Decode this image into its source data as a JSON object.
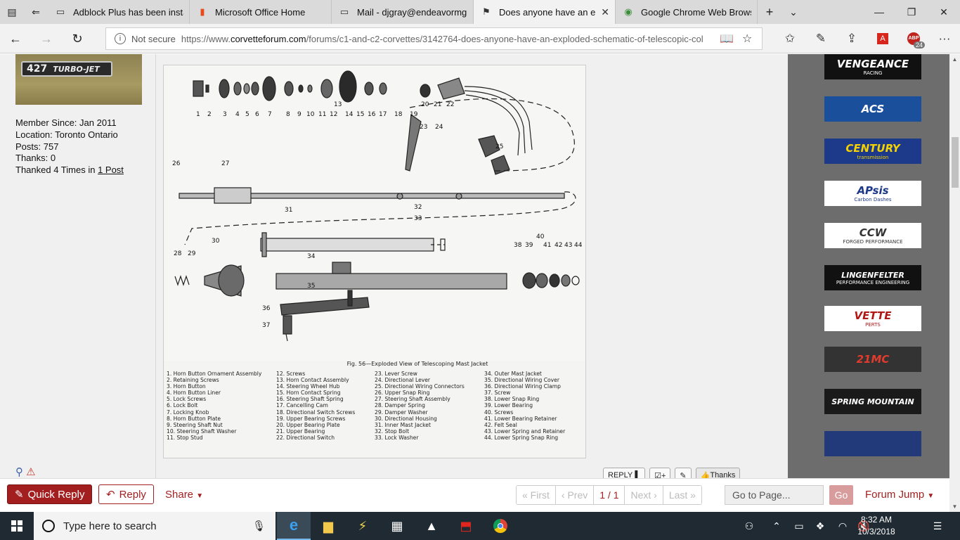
{
  "browser": {
    "tabs": [
      {
        "title": "Adblock Plus has been insta",
        "icon": "document-icon",
        "active": false
      },
      {
        "title": "Microsoft Office Home",
        "icon": "office-icon",
        "active": false
      },
      {
        "title": "Mail - djgray@endeavormg",
        "icon": "mail-icon",
        "active": false
      },
      {
        "title": "Does anyone have an e",
        "icon": "corvette-flag-icon",
        "active": true
      },
      {
        "title": "Google Chrome Web Brows",
        "icon": "chrome-icon",
        "active": false
      }
    ],
    "not_secure": "Not secure",
    "url_prefix": "https://www.",
    "url_domain": "corvetteforum.com",
    "url_path": "/forums/c1-and-c2-corvettes/3142764-does-anyone-have-an-exploded-schematic-of-telescopic-col",
    "abp_count": "24"
  },
  "member": {
    "avatar_text": "427",
    "avatar_subtext": "TURBO-JET",
    "since": "Member Since: Jan 2011",
    "location": "Location: Toronto Ontario",
    "posts": "Posts: 757",
    "thanks": "Thanks: 0",
    "thanked_prefix": "Thanked 4 Times in ",
    "thanked_link": "1 Post"
  },
  "diagram": {
    "caption": "Fig. 56—Exploded View of Telescoping Mast Jacket",
    "callouts_top": [
      "1",
      "2",
      "3",
      "4",
      "5",
      "6",
      "7",
      "8",
      "9",
      "10",
      "11",
      "12",
      "13",
      "14",
      "15",
      "16",
      "17",
      "18",
      "19",
      "20",
      "21",
      "22"
    ],
    "callouts_other": [
      "23",
      "24",
      "25",
      "26",
      "27",
      "31",
      "32",
      "33",
      "28",
      "29",
      "30",
      "34",
      "35",
      "36",
      "37",
      "38",
      "39",
      "40",
      "41",
      "42",
      "43",
      "44"
    ],
    "legend": [
      [
        "1. Horn Button Ornament Assembly",
        "2. Retaining Screws",
        "3. Horn Button",
        "4. Horn Button Liner",
        "5. Lock Screws",
        "6. Lock Bolt",
        "7. Locking Knob",
        "8. Horn Button Plate",
        "9. Steering Shaft Nut",
        "10. Steering Shaft Washer",
        "11. Stop Stud"
      ],
      [
        "12. Screws",
        "13. Horn Contact Assembly",
        "14. Steering Wheel Hub",
        "15. Horn Contact Spring",
        "16. Steering Shaft Spring",
        "17. Cancelling Cam",
        "18. Directional Switch Screws",
        "19. Upper Bearing Screws",
        "20. Upper Bearing Plate",
        "21. Upper Bearing",
        "22. Directional Switch"
      ],
      [
        "23. Lever Screw",
        "24. Directional Lever",
        "25. Directional Wiring Connectors",
        "26. Upper Snap Ring",
        "27. Steering Shaft Assembly",
        "28. Damper Spring",
        "29. Damper Washer",
        "30. Directional Housing",
        "31. Inner Mast Jacket",
        "32. Stop Bolt",
        "33. Lock Washer"
      ],
      [
        "34. Outer Mast Jacket",
        "35. Directional Wiring Cover",
        "36. Directional Wiring Clamp",
        "37. Screw",
        "38. Lower Snap Ring",
        "39. Lower Bearing",
        "40. Screws",
        "41. Lower Bearing Retainer",
        "42. Felt Seal",
        "43. Lower Spring and Retainer",
        "44. Lower Spring Snap Ring"
      ]
    ]
  },
  "post_buttons": {
    "reply": "REPLY",
    "thanks": "Thanks"
  },
  "ads": [
    {
      "text": "VENGEANCE",
      "sub": "RACING",
      "bg": "#111111",
      "fg": "#ffffff"
    },
    {
      "text": "ACS",
      "sub": "",
      "bg": "#1a4f9c",
      "fg": "#ffffff"
    },
    {
      "text": "CENTURY",
      "sub": "transmission",
      "bg": "#1d3a8a",
      "fg": "#f5d200"
    },
    {
      "text": "APsis",
      "sub": "Carbon Dashes",
      "bg": "#ffffff",
      "fg": "#1d3a8a"
    },
    {
      "text": "CCW",
      "sub": "FORGED PERFORMANCE",
      "bg": "#ffffff",
      "fg": "#333333"
    },
    {
      "text": "LINGENFELTER",
      "sub": "PERFORMANCE ENGINEERING",
      "bg": "#111111",
      "fg": "#ffffff"
    },
    {
      "text": "VETTE",
      "sub": "PERTS",
      "bg": "#ffffff",
      "fg": "#b01818"
    },
    {
      "text": "21MC",
      "sub": "",
      "bg": "#333333",
      "fg": "#e23b2e"
    },
    {
      "text": "SPRING MOUNTAIN",
      "sub": "",
      "bg": "#1a1a1a",
      "fg": "#ffffff"
    },
    {
      "text": "",
      "sub": "",
      "bg": "#233a7a",
      "fg": "#ffffff"
    }
  ],
  "bottom_bar": {
    "quick_reply": "Quick Reply",
    "reply": "Reply",
    "share": "Share",
    "pager": {
      "first": "« First",
      "prev": "‹ Prev",
      "current": "1 / 1",
      "next": "Next ›",
      "last": "Last »"
    },
    "goto_placeholder": "Go to Page...",
    "go": "Go",
    "forum_jump": "Forum Jump"
  },
  "taskbar": {
    "search_placeholder": "Type here to search",
    "time": "8:32 AM",
    "date": "10/3/2018"
  }
}
